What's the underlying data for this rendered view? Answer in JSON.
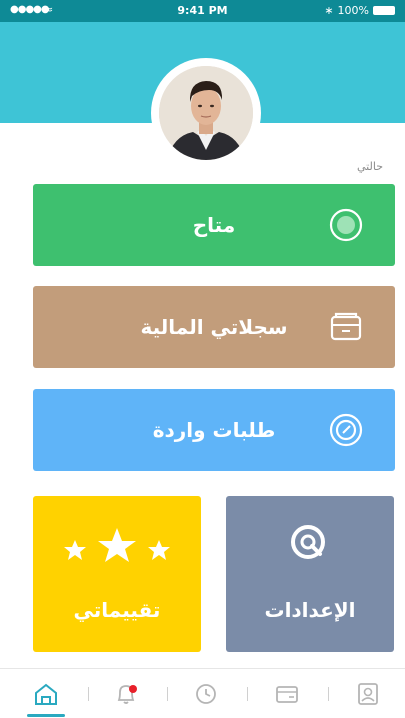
{
  "status_bar": {
    "signal": "●●●●●",
    "wifi": "≈",
    "time": "9:41 PM",
    "bluetooth": "∗",
    "battery": "100%"
  },
  "profile": {
    "status_label": "حالتي"
  },
  "cards": [
    {
      "label": "متاح",
      "color": "#3ec06f",
      "icon": "radio-on-icon"
    },
    {
      "label": "سجلاتي المالية",
      "color": "#c29d7b",
      "icon": "wallet-icon"
    },
    {
      "label": "طلبات واردة",
      "color": "#5fb4f8",
      "icon": "target-icon"
    }
  ],
  "tiles": {
    "ratings": {
      "label": "تقييماتي",
      "color": "#ffd200",
      "icon": "stars-icon"
    },
    "settings": {
      "label": "الإعدادات",
      "color": "#7b8ca8",
      "icon": "settings-search-icon"
    }
  },
  "tabbar": {
    "items": [
      "home-icon",
      "bell-icon",
      "history-icon",
      "wallet-icon",
      "profile-icon"
    ],
    "active": "home-icon",
    "accent": "#2aa9c0",
    "notification_dot": "#e8202a"
  }
}
